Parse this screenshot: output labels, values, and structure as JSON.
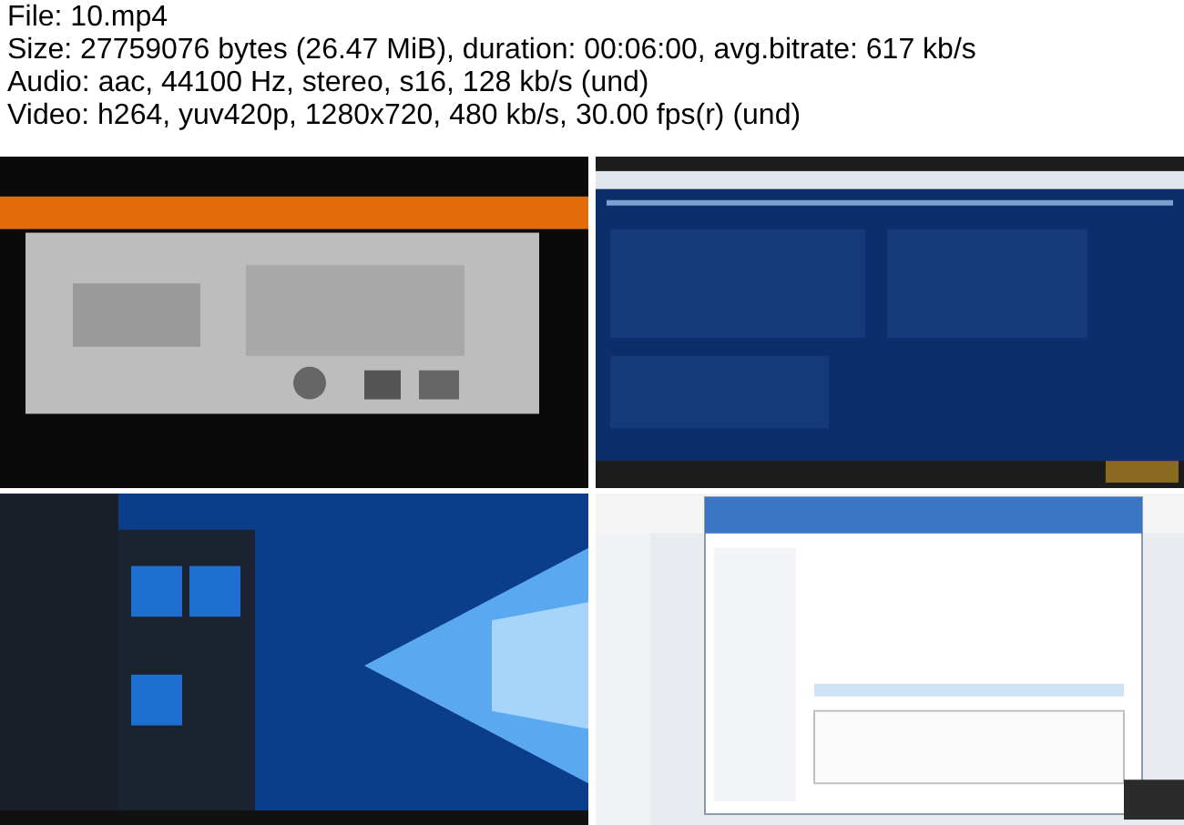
{
  "info_lines": [
    "File: 10.mp4",
    "Size: 27759076 bytes (26.47 MiB), duration: 00:06:00, avg.bitrate: 617 kb/s",
    "Audio: aac, 44100 Hz, stereo, s16, 128 kb/s (und)",
    "Video: h264, yuv420p, 1280x720, 480 kb/s, 30.00 fps(r) (und)"
  ]
}
